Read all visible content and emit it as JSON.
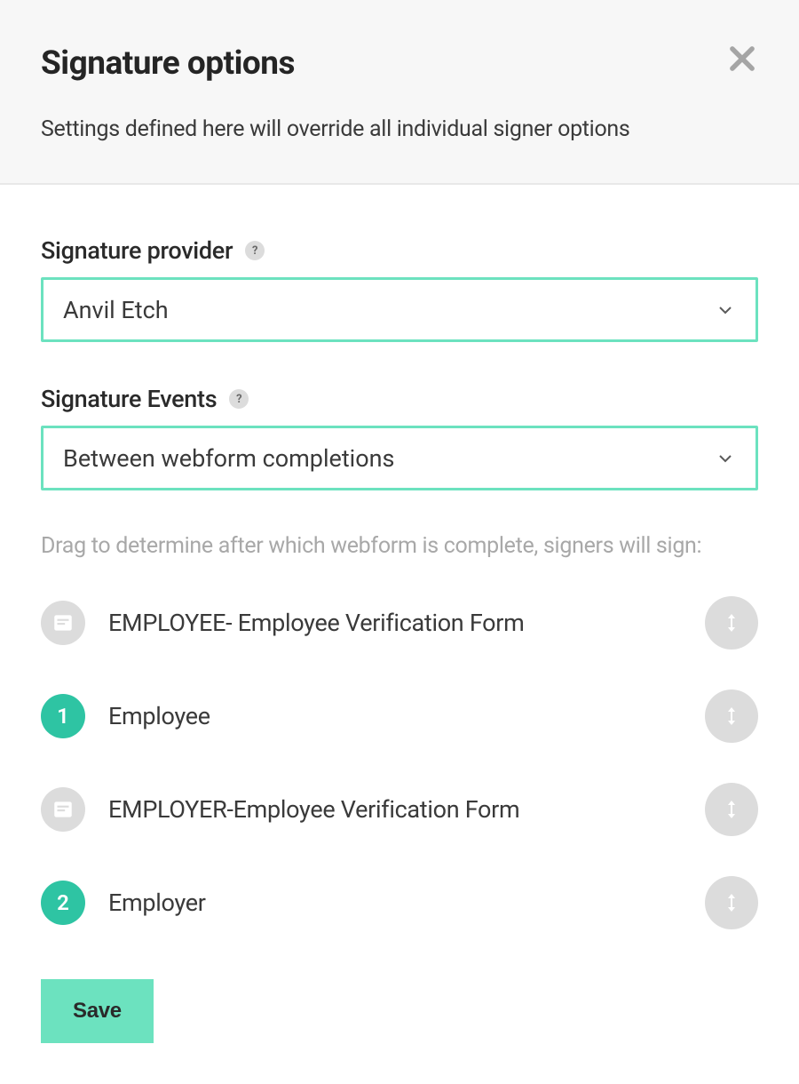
{
  "header": {
    "title": "Signature options",
    "subtitle": "Settings defined here will override all individual signer options"
  },
  "form": {
    "provider": {
      "label": "Signature provider",
      "value": "Anvil Etch",
      "help": "?"
    },
    "events": {
      "label": "Signature Events",
      "value": "Between webform completions",
      "help": "?"
    }
  },
  "drag": {
    "instruction": "Drag to determine after which webform is complete, signers will sign:",
    "items": [
      {
        "type": "form",
        "label": "EMPLOYEE- Employee Verification Form"
      },
      {
        "type": "signer",
        "number": "1",
        "label": "Employee"
      },
      {
        "type": "form",
        "label": "EMPLOYER-Employee Verification Form"
      },
      {
        "type": "signer",
        "number": "2",
        "label": "Employer"
      }
    ]
  },
  "buttons": {
    "save": "Save"
  }
}
